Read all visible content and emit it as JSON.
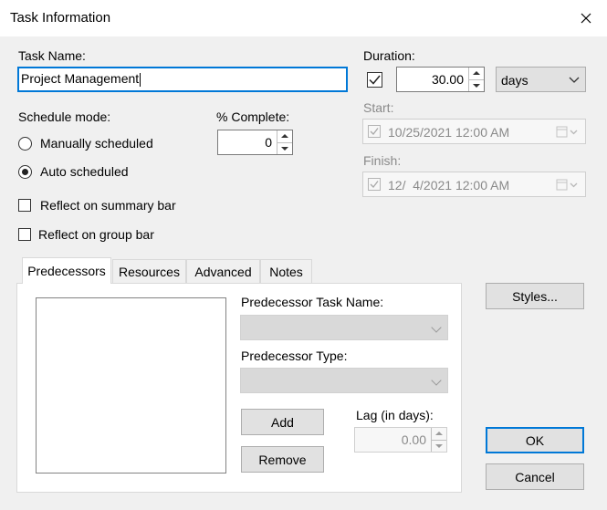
{
  "window": {
    "title": "Task Information"
  },
  "task_name": {
    "label": "Task Name:",
    "value": "Project Management"
  },
  "schedule_mode": {
    "label": "Schedule mode:",
    "options": [
      "Manually scheduled",
      "Auto scheduled"
    ],
    "selected": "Auto scheduled"
  },
  "percent_complete": {
    "label": "% Complete:",
    "value": "0"
  },
  "reflect_summary": {
    "label": "Reflect on summary bar",
    "checked": false
  },
  "reflect_group": {
    "label": "Reflect on group bar",
    "checked": false
  },
  "duration": {
    "label": "Duration:",
    "checked": true,
    "value": "30.00",
    "unit": "days"
  },
  "start": {
    "label": "Start:",
    "value": "10/25/2021 12:00 AM"
  },
  "finish": {
    "label": "Finish:",
    "value": "12/  4/2021 12:00 AM"
  },
  "tabs": [
    {
      "label": "Predecessors",
      "active": true
    },
    {
      "label": "Resources",
      "active": false
    },
    {
      "label": "Advanced",
      "active": false
    },
    {
      "label": "Notes",
      "active": false
    }
  ],
  "predecessors": {
    "task_name_label": "Predecessor Task Name:",
    "type_label": "Predecessor Type:",
    "lag_label": "Lag (in days):",
    "lag_value": "0.00",
    "add_label": "Add",
    "remove_label": "Remove"
  },
  "buttons": {
    "styles": "Styles...",
    "ok": "OK",
    "cancel": "Cancel"
  },
  "colors": {
    "accent": "#0078d7",
    "panel_bg": "#f0f0f0",
    "disabled_text": "#8a8a8a"
  }
}
